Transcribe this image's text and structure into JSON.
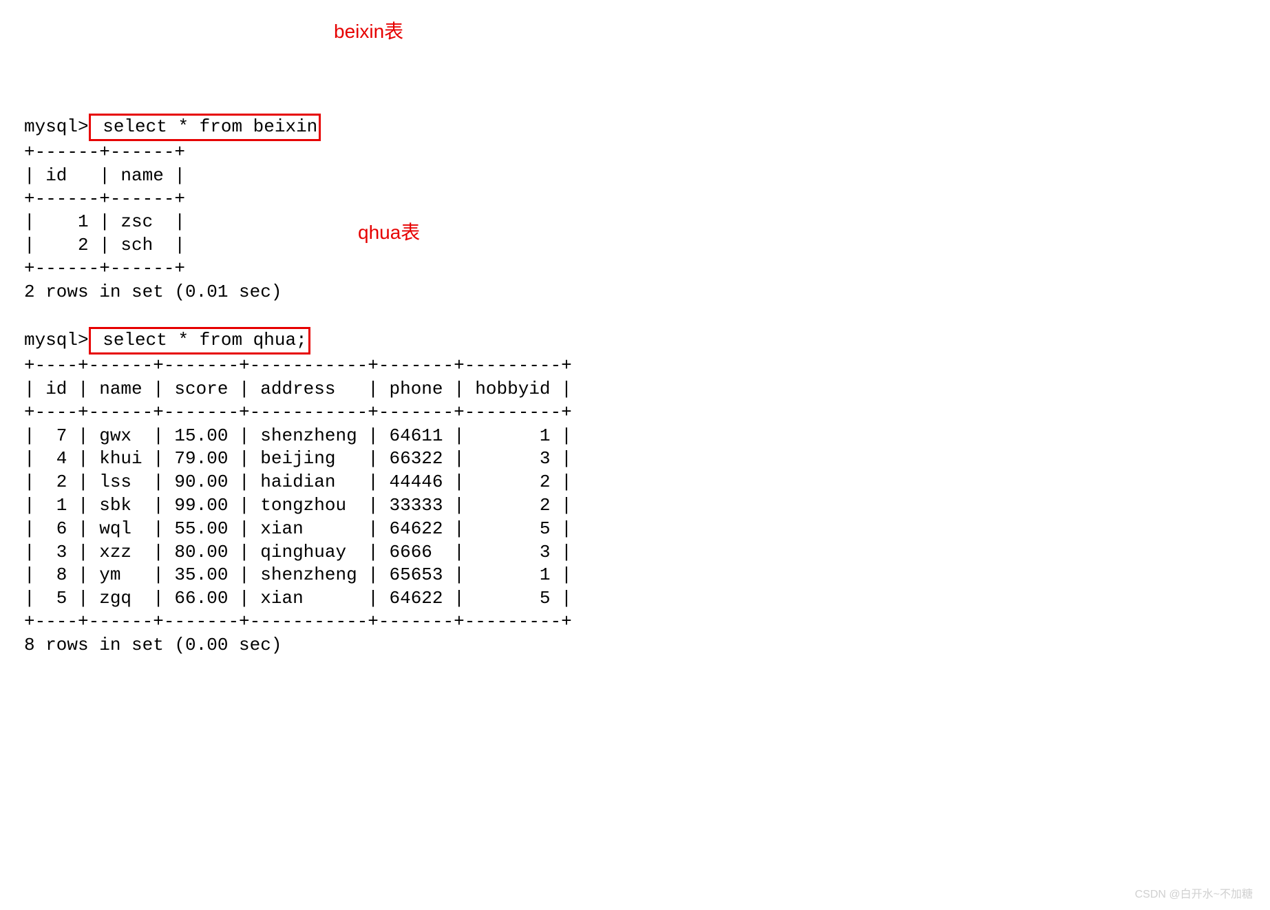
{
  "prompt": "mysql>",
  "query1": {
    "text": " select * from beixin",
    "annotation": "beixin表",
    "divider": "+------+------+",
    "header": "| id   | name |",
    "rows": [
      "|    1 | zsc  |",
      "|    2 | sch  |"
    ],
    "footer": "2 rows in set (0.01 sec)"
  },
  "query2": {
    "text": " select * from qhua;",
    "annotation": "qhua表",
    "divider": "+----+------+-------+-----------+-------+---------+",
    "header": "| id | name | score | address   | phone | hobbyid |",
    "rows": [
      "|  7 | gwx  | 15.00 | shenzheng | 64611 |       1 |",
      "|  4 | khui | 79.00 | beijing   | 66322 |       3 |",
      "|  2 | lss  | 90.00 | haidian   | 44446 |       2 |",
      "|  1 | sbk  | 99.00 | tongzhou  | 33333 |       2 |",
      "|  6 | wql  | 55.00 | xian      | 64622 |       5 |",
      "|  3 | xzz  | 80.00 | qinghuay  | 6666  |       3 |",
      "|  8 | ym   | 35.00 | shenzheng | 65653 |       1 |",
      "|  5 | zgq  | 66.00 | xian      | 64622 |       5 |"
    ],
    "footer": "8 rows in set (0.00 sec)"
  },
  "watermark": "CSDN @白开水~不加糖",
  "chart_data": {
    "type": "table",
    "tables": [
      {
        "name": "beixin",
        "columns": [
          "id",
          "name"
        ],
        "rows": [
          [
            1,
            "zsc"
          ],
          [
            2,
            "sch"
          ]
        ],
        "row_count": 2,
        "query_time_sec": 0.01
      },
      {
        "name": "qhua",
        "columns": [
          "id",
          "name",
          "score",
          "address",
          "phone",
          "hobbyid"
        ],
        "rows": [
          [
            7,
            "gwx",
            15.0,
            "shenzheng",
            64611,
            1
          ],
          [
            4,
            "khui",
            79.0,
            "beijing",
            66322,
            3
          ],
          [
            2,
            "lss",
            90.0,
            "haidian",
            44446,
            2
          ],
          [
            1,
            "sbk",
            99.0,
            "tongzhou",
            33333,
            2
          ],
          [
            6,
            "wql",
            55.0,
            "xian",
            64622,
            5
          ],
          [
            3,
            "xzz",
            80.0,
            "qinghuay",
            6666,
            3
          ],
          [
            8,
            "ym",
            35.0,
            "shenzheng",
            65653,
            1
          ],
          [
            5,
            "zgq",
            66.0,
            "xian",
            64622,
            5
          ]
        ],
        "row_count": 8,
        "query_time_sec": 0.0
      }
    ]
  }
}
